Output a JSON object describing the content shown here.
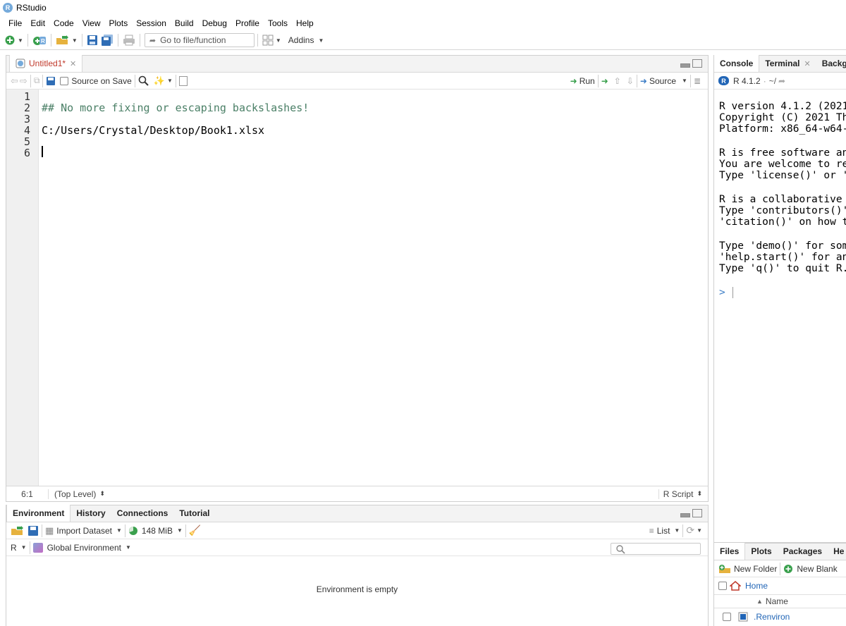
{
  "window": {
    "title": "RStudio"
  },
  "menu": [
    "File",
    "Edit",
    "Code",
    "View",
    "Plots",
    "Session",
    "Build",
    "Debug",
    "Profile",
    "Tools",
    "Help"
  ],
  "toolbar": {
    "goto_placeholder": "Go to file/function",
    "addins_label": "Addins"
  },
  "source": {
    "tab_label": "Untitled1*",
    "source_on_save_label": "Source on Save",
    "run_label": "Run",
    "source_label": "Source",
    "line_numbers": [
      "1",
      "2",
      "3",
      "4",
      "5",
      "6"
    ],
    "lines": [
      "",
      "## No more fixing or escaping backslashes!",
      "",
      "C:/Users/Crystal/Desktop/Book1.xlsx",
      "",
      ""
    ],
    "status_position": "6:1",
    "status_scope": "(Top Level)",
    "status_filetype": "R Script"
  },
  "env": {
    "tabs": [
      "Environment",
      "History",
      "Connections",
      "Tutorial"
    ],
    "import_label": "Import Dataset",
    "memory_label": "148 MiB",
    "list_label": "List",
    "lang_label": "R",
    "scope_label": "Global Environment",
    "empty_message": "Environment is empty"
  },
  "console": {
    "tabs": [
      "Console",
      "Terminal",
      "Backg"
    ],
    "version_label": "R 4.1.2",
    "path_label": "~/",
    "lines": [
      "R version 4.1.2 (2021",
      "Copyright (C) 2021 Th",
      "Platform: x86_64-w64-",
      "",
      "R is free software an",
      "You are welcome to re",
      "Type 'license()' or '",
      "",
      "R is a collaborative ",
      "Type 'contributors()'",
      "'citation()' on how t",
      "",
      "Type 'demo()' for som",
      "'help.start()' for an",
      "Type 'q()' to quit R."
    ],
    "prompt": ">"
  },
  "files": {
    "tabs": [
      "Files",
      "Plots",
      "Packages",
      "He"
    ],
    "new_folder_label": "New Folder",
    "new_blank_label": "New Blank",
    "home_label": "Home",
    "name_header": "Name",
    "items": [
      ".Renviron"
    ]
  }
}
